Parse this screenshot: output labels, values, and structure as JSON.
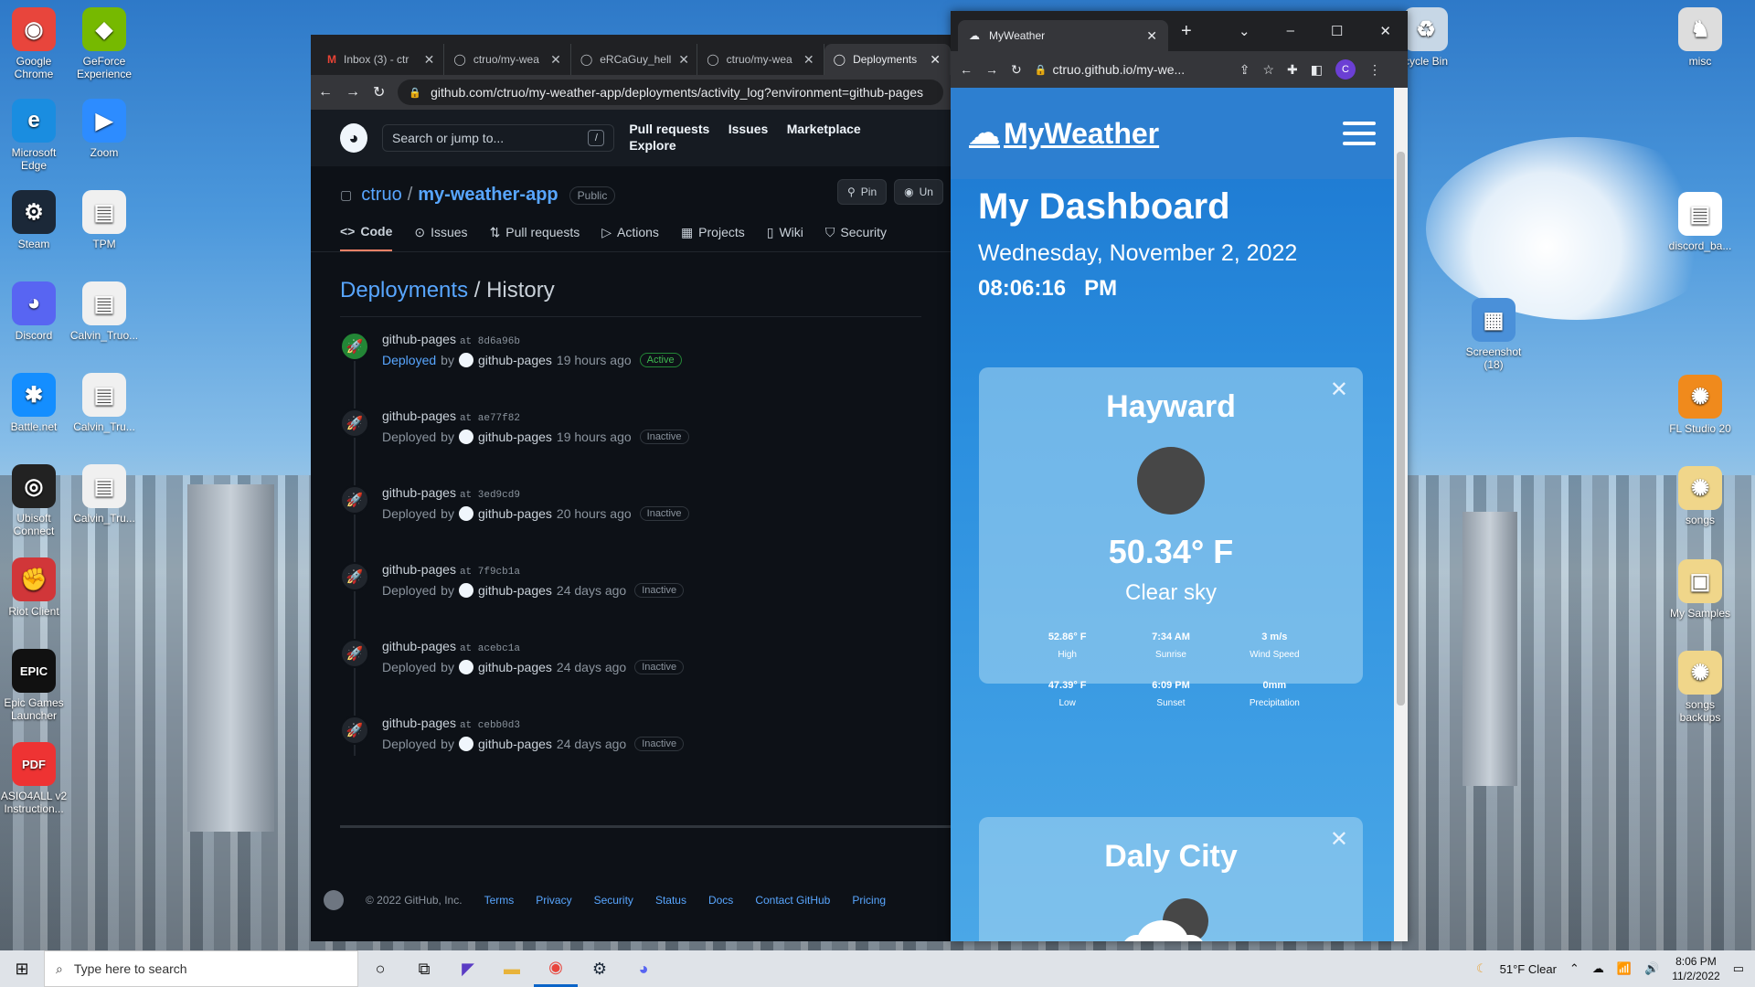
{
  "desktop": {
    "left_icons": [
      {
        "label": "Google Chrome",
        "glyph": "◉",
        "color": "#e8453c"
      },
      {
        "label": "GeForce Experience",
        "glyph": "◆",
        "color": "#76b900"
      },
      {
        "label": "Microsoft Edge",
        "glyph": "e",
        "color": "#1a8de0"
      },
      {
        "label": "Zoom",
        "glyph": "▶",
        "color": "#2d8cff"
      },
      {
        "label": "Steam",
        "glyph": "⚙",
        "color": "#1b2838"
      },
      {
        "label": "TPM",
        "glyph": "▤",
        "color": "#f0f0f0"
      },
      {
        "label": "Discord",
        "glyph": "◕",
        "color": "#5865f2"
      },
      {
        "label": "Calvin_Truo...",
        "glyph": "▤",
        "color": "#f0f0f0"
      },
      {
        "label": "Battle.net",
        "glyph": "✱",
        "color": "#148eff"
      },
      {
        "label": "Calvin_Tru...",
        "glyph": "▤",
        "color": "#f0f0f0"
      },
      {
        "label": "Ubisoft Connect",
        "glyph": "◎",
        "color": "#222"
      },
      {
        "label": "Calvin_Tru...",
        "glyph": "▤",
        "color": "#f0f0f0"
      },
      {
        "label": "Riot Client",
        "glyph": "✊",
        "color": "#d13639"
      },
      {
        "label": "Epic Games Launcher",
        "glyph": "EPIC",
        "color": "#111"
      },
      {
        "label": "ASIO4ALL v2 Instruction...",
        "glyph": "PDF",
        "color": "#e33"
      }
    ],
    "right_icons": [
      {
        "label": "cycle Bin",
        "glyph": "♻",
        "color": "#c7d7e6"
      },
      {
        "label": "misc",
        "glyph": "♞",
        "color": "#ddd"
      },
      {
        "label": "discord_ba...",
        "glyph": "▤",
        "color": "#fff"
      },
      {
        "label": "Screenshot (18)",
        "glyph": "▦",
        "color": "#4a90d9"
      },
      {
        "label": "FL Studio 20",
        "glyph": "✺",
        "color": "#f08a1c"
      },
      {
        "label": "songs",
        "glyph": "✺",
        "color": "#f0d68a"
      },
      {
        "label": "My Samples",
        "glyph": "▣",
        "color": "#f0d68a"
      },
      {
        "label": "songs backups",
        "glyph": "✺",
        "color": "#f0d68a"
      }
    ]
  },
  "github_window": {
    "tabs": [
      {
        "label": "Inbox (3) - ctr",
        "icon": "M"
      },
      {
        "label": "ctruo/my-wea",
        "icon": "◯"
      },
      {
        "label": "eRCaGuy_hell",
        "icon": "◯"
      },
      {
        "label": "ctruo/my-wea",
        "icon": "◯"
      },
      {
        "label": "Deployments",
        "icon": "◯"
      }
    ],
    "url": "github.com/ctruo/my-weather-app/deployments/activity_log?environment=github-pages",
    "search_placeholder": "Search or jump to...",
    "search_key": "/",
    "nav": [
      "Pull requests",
      "Issues",
      "Marketplace",
      "Explore"
    ],
    "repo_owner": "ctruo",
    "repo_sep": "/",
    "repo_name": "my-weather-app",
    "visibility": "Public",
    "pin_label": "Pin",
    "unwatch_label": "Un",
    "repo_tabs": [
      "Code",
      "Issues",
      "Pull requests",
      "Actions",
      "Projects",
      "Wiki",
      "Security"
    ],
    "crumb_link": "Deployments",
    "crumb_rest": " / History",
    "deployments": [
      {
        "env": "github-pages",
        "sha": "at 8d6a96b",
        "deployed": "Deployed",
        "by": "by",
        "actor": "github-pages",
        "when": "19 hours ago",
        "status": "Active"
      },
      {
        "env": "github-pages",
        "sha": "at ae77f82",
        "deployed": "Deployed",
        "by": "by",
        "actor": "github-pages",
        "when": "19 hours ago",
        "status": "Inactive"
      },
      {
        "env": "github-pages",
        "sha": "at 3ed9cd9",
        "deployed": "Deployed",
        "by": "by",
        "actor": "github-pages",
        "when": "20 hours ago",
        "status": "Inactive"
      },
      {
        "env": "github-pages",
        "sha": "at 7f9cb1a",
        "deployed": "Deployed",
        "by": "by",
        "actor": "github-pages",
        "when": "24 days ago",
        "status": "Inactive"
      },
      {
        "env": "github-pages",
        "sha": "at acebc1a",
        "deployed": "Deployed",
        "by": "by",
        "actor": "github-pages",
        "when": "24 days ago",
        "status": "Inactive"
      },
      {
        "env": "github-pages",
        "sha": "at cebb0d3",
        "deployed": "Deployed",
        "by": "by",
        "actor": "github-pages",
        "when": "24 days ago",
        "status": "Inactive"
      }
    ],
    "footer": {
      "copyright": "© 2022 GitHub, Inc.",
      "links": [
        "Terms",
        "Privacy",
        "Security",
        "Status",
        "Docs",
        "Contact GitHub",
        "Pricing"
      ]
    }
  },
  "weather_window": {
    "tab_title": "MyWeather",
    "url": "ctruo.github.io/my-we...",
    "profile_initial": "C",
    "brand": "MyWeather",
    "heading": "My Dashboard",
    "date": "Wednesday, November 2, 2022",
    "time": "08:06:16",
    "ampm": "PM",
    "cards": [
      {
        "city": "Hayward",
        "temp": "50.34° F",
        "desc": "Clear sky",
        "stats": [
          {
            "value": "52.86° F",
            "label": "High"
          },
          {
            "value": "7:34 AM",
            "label": "Sunrise"
          },
          {
            "value": "3 m/s",
            "label": "Wind Speed"
          },
          {
            "value": "47.39° F",
            "label": "Low"
          },
          {
            "value": "6:09 PM",
            "label": "Sunset"
          },
          {
            "value": "0mm",
            "label": "Precipitation"
          }
        ]
      },
      {
        "city": "Daly City"
      }
    ]
  },
  "taskbar": {
    "search_placeholder": "Type here to search",
    "weather": "51°F  Clear",
    "time": "8:06 PM",
    "date": "11/2/2022"
  }
}
